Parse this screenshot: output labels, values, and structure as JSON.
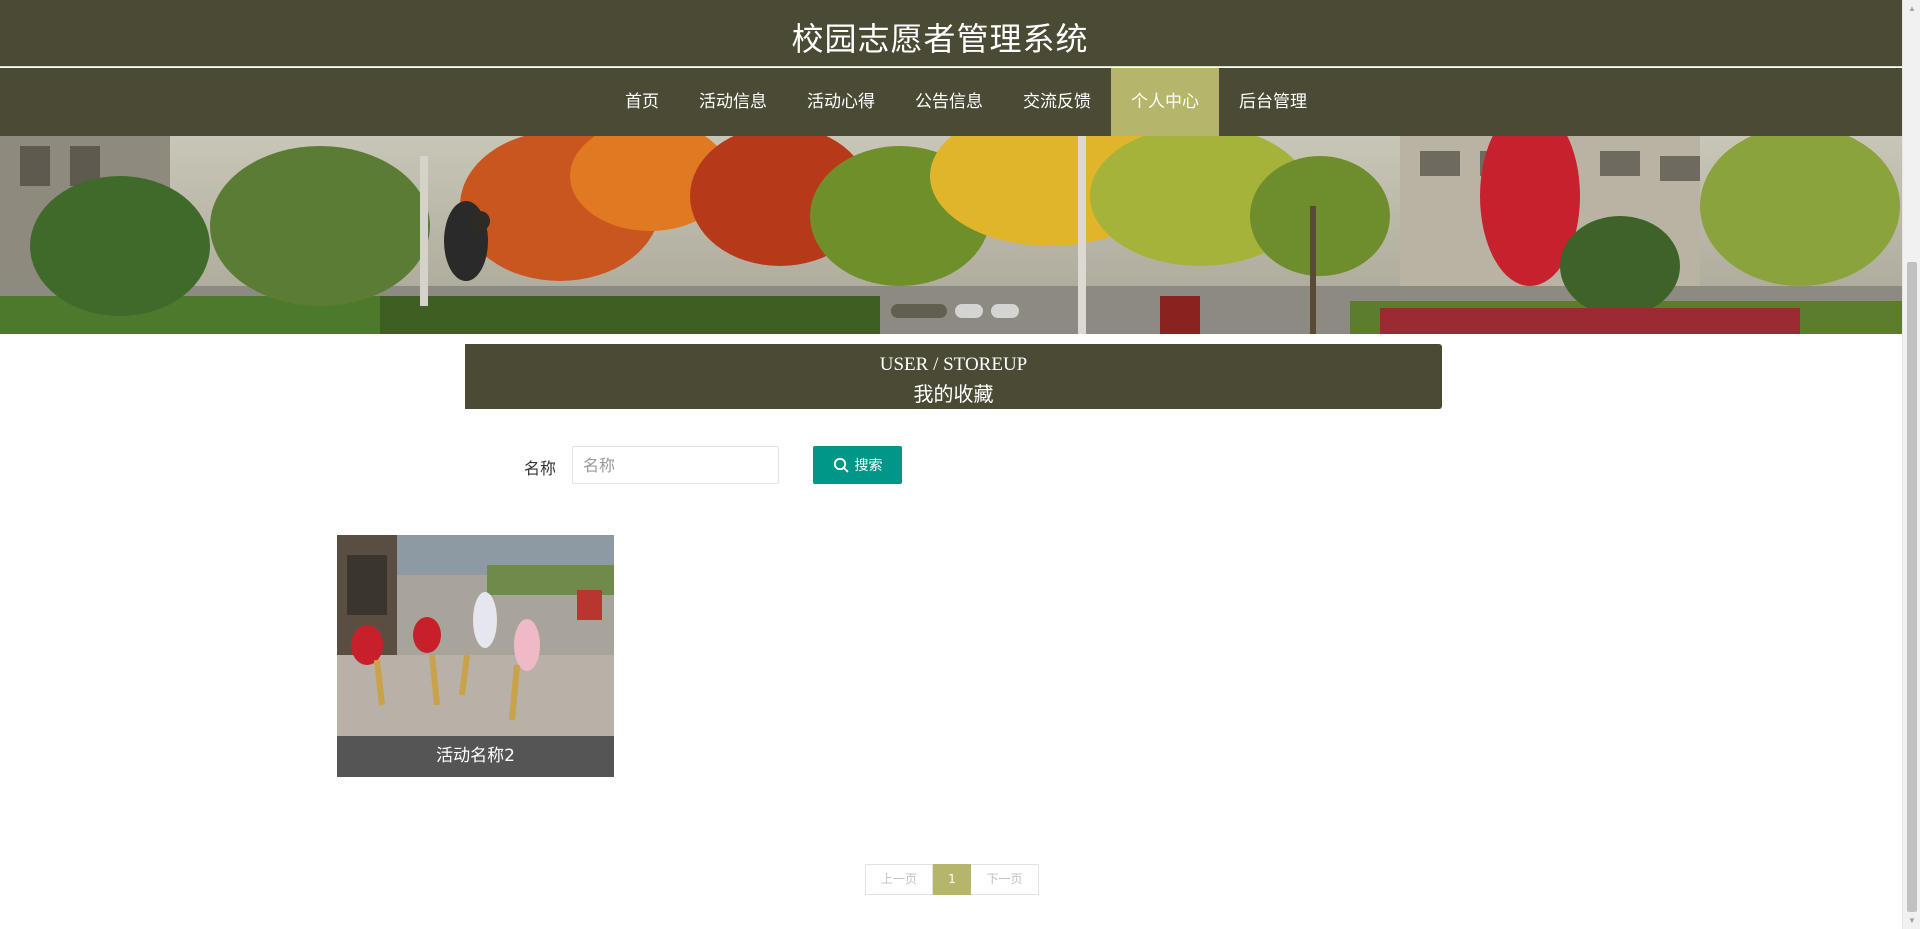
{
  "site": {
    "title": "校园志愿者管理系统"
  },
  "nav": {
    "items": [
      {
        "label": "首页"
      },
      {
        "label": "活动信息"
      },
      {
        "label": "活动心得"
      },
      {
        "label": "公告信息"
      },
      {
        "label": "交流反馈"
      },
      {
        "label": "个人中心",
        "active": true
      },
      {
        "label": "后台管理"
      }
    ]
  },
  "banner": {
    "slide_count": 3,
    "active_slide": 1
  },
  "section": {
    "title_en": "USER / STOREUP",
    "title_cn": "我的收藏"
  },
  "search": {
    "label": "名称",
    "placeholder": "名称",
    "value": "",
    "button_label": "搜索"
  },
  "favorites": [
    {
      "name": "活动名称2"
    }
  ],
  "pagination": {
    "prev_label": "上一页",
    "current_page": "1",
    "next_label": "下一页"
  },
  "colors": {
    "header_bg": "#4b4b35",
    "accent": "#b5b56b",
    "search_button": "#009688",
    "caption_bg": "#555555"
  }
}
